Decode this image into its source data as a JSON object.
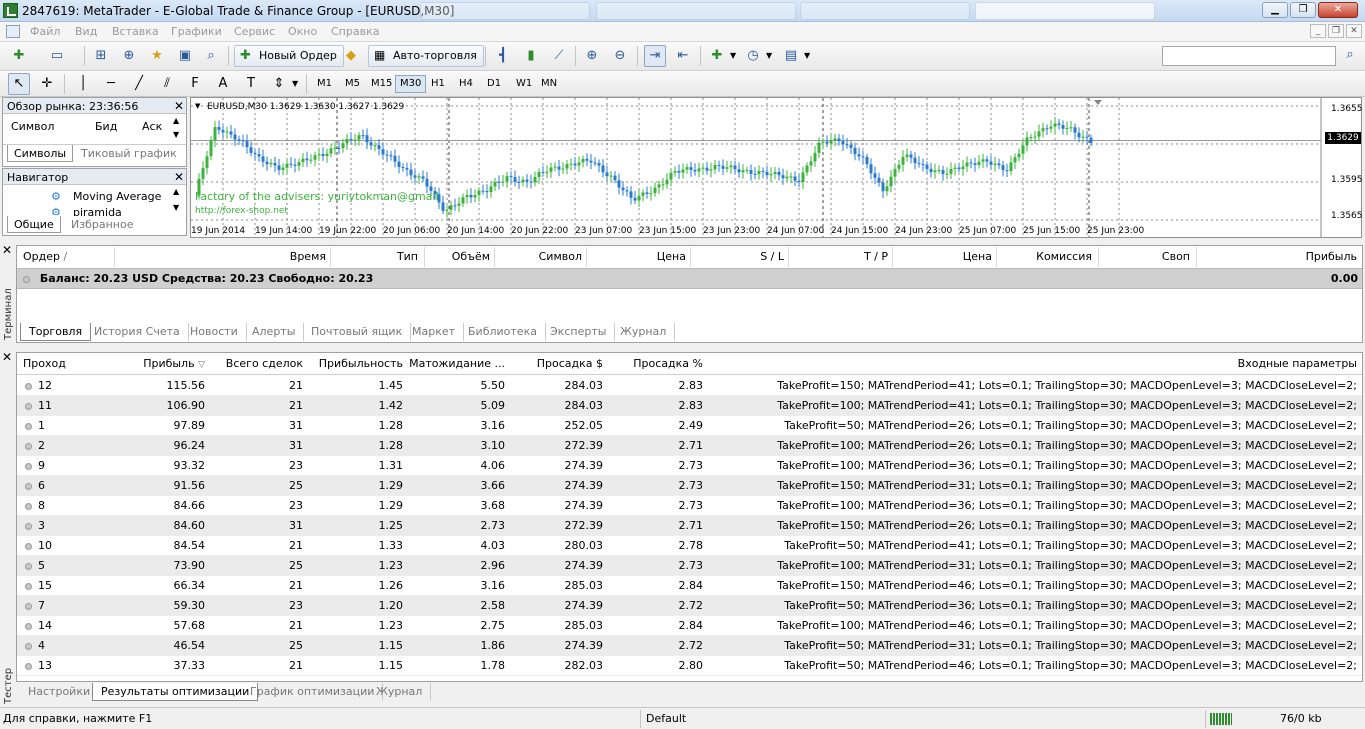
{
  "window": {
    "title": "2847619: MetaTrader - E-Global Trade & Finance Group - [EURUSD,M30]"
  },
  "menu": {
    "items": [
      "Файл",
      "Вид",
      "Вставка",
      "Графики",
      "Сервис",
      "Окно",
      "Справка"
    ]
  },
  "toolbar": {
    "new_order_label": "Новый Ордер",
    "autotrading_label": "Авто-торговля"
  },
  "timeframes": [
    "M1",
    "M5",
    "M15",
    "M30",
    "H1",
    "H4",
    "D1",
    "W1",
    "MN"
  ],
  "active_timeframe": "M30",
  "market_watch": {
    "title": "Обзор рынка: 23:36:56",
    "columns": {
      "symbol": "Символ",
      "bid": "Бид",
      "ask": "Аск"
    },
    "tabs": [
      "Символы",
      "Тиковый график"
    ]
  },
  "navigator": {
    "title": "Навигатор",
    "items": [
      "Moving Average",
      "piramida"
    ],
    "tabs": [
      "Общие",
      "Избранное"
    ]
  },
  "chart": {
    "header": "EURUSD,M30  1.3629 1.3630 1.3627 1.3629",
    "watermark_line1": "Factory of the advisers: yuriytokman@gmail",
    "watermark_line2": "http://forex-shop.net",
    "current_price": "1.3629",
    "bull_color": "#3cb43c",
    "bear_color": "#2a7bd0",
    "chart_data": {
      "type": "candlestick",
      "x_ticks": [
        "19 Jun 2014",
        "19 Jun 14:00",
        "19 Jun 22:00",
        "20 Jun 06:00",
        "20 Jun 14:00",
        "20 Jun 22:00",
        "23 Jun 07:00",
        "23 Jun 15:00",
        "23 Jun 23:00",
        "24 Jun 07:00",
        "24 Jun 15:00",
        "24 Jun 23:00",
        "25 Jun 07:00",
        "25 Jun 15:00",
        "25 Jun 23:00"
      ],
      "y_ticks": [
        "1.3655",
        "1.3629",
        "1.3595",
        "1.3565"
      ],
      "ylim": [
        1.356,
        1.366
      ],
      "close_path": [
        1.3585,
        1.364,
        1.3632,
        1.3614,
        1.3608,
        1.361,
        1.3618,
        1.3625,
        1.3633,
        1.362,
        1.3605,
        1.3598,
        1.357,
        1.3585,
        1.3588,
        1.36,
        1.3595,
        1.3606,
        1.361,
        1.3612,
        1.36,
        1.358,
        1.359,
        1.3603,
        1.3606,
        1.3608,
        1.3605,
        1.3604,
        1.36,
        1.3598,
        1.3626,
        1.363,
        1.3615,
        1.3588,
        1.3618,
        1.3606,
        1.3604,
        1.3608,
        1.3614,
        1.3604,
        1.3632,
        1.3641,
        1.3638,
        1.3629
      ]
    }
  },
  "terminal": {
    "side_label": "Терминал",
    "columns": [
      "Ордер",
      "Время",
      "Тип",
      "Объём",
      "Символ",
      "Цена",
      "S / L",
      "T / P",
      "Цена",
      "Комиссия",
      "Своп",
      "Прибыль"
    ],
    "balance_text": "Баланс: 20.23 USD  Средства: 20.23  Свободно: 20.23",
    "balance_profit": "0.00",
    "tabs": [
      "Торговля",
      "История Счета",
      "Новости",
      "Алерты",
      "Почтовый ящик",
      "Маркет",
      "Библиотека",
      "Эксперты",
      "Журнал"
    ]
  },
  "tester": {
    "side_label": "Тестер",
    "columns": [
      "Проход",
      "Прибыль",
      "Всего сделок",
      "Прибыльность",
      "Матожидание ...",
      "Просадка $",
      "Просадка %",
      "Входные параметры"
    ],
    "rows": [
      [
        "12",
        "115.56",
        "21",
        "1.45",
        "5.50",
        "284.03",
        "2.83",
        "TakeProfit=150; MATrendPeriod=41; Lots=0.1; TrailingStop=30; MACDOpenLevel=3; MACDCloseLevel=2;"
      ],
      [
        "11",
        "106.90",
        "21",
        "1.42",
        "5.09",
        "284.03",
        "2.83",
        "TakeProfit=100; MATrendPeriod=41; Lots=0.1; TrailingStop=30; MACDOpenLevel=3; MACDCloseLevel=2;"
      ],
      [
        "1",
        "97.89",
        "31",
        "1.28",
        "3.16",
        "252.05",
        "2.49",
        "TakeProfit=50; MATrendPeriod=26; Lots=0.1; TrailingStop=30; MACDOpenLevel=3; MACDCloseLevel=2;"
      ],
      [
        "2",
        "96.24",
        "31",
        "1.28",
        "3.10",
        "272.39",
        "2.71",
        "TakeProfit=100; MATrendPeriod=26; Lots=0.1; TrailingStop=30; MACDOpenLevel=3; MACDCloseLevel=2;"
      ],
      [
        "9",
        "93.32",
        "23",
        "1.31",
        "4.06",
        "274.39",
        "2.73",
        "TakeProfit=100; MATrendPeriod=36; Lots=0.1; TrailingStop=30; MACDOpenLevel=3; MACDCloseLevel=2;"
      ],
      [
        "6",
        "91.56",
        "25",
        "1.29",
        "3.66",
        "274.39",
        "2.73",
        "TakeProfit=150; MATrendPeriod=31; Lots=0.1; TrailingStop=30; MACDOpenLevel=3; MACDCloseLevel=2;"
      ],
      [
        "8",
        "84.66",
        "23",
        "1.29",
        "3.68",
        "274.39",
        "2.73",
        "TakeProfit=100; MATrendPeriod=36; Lots=0.1; TrailingStop=30; MACDOpenLevel=3; MACDCloseLevel=2;"
      ],
      [
        "3",
        "84.60",
        "31",
        "1.25",
        "2.73",
        "272.39",
        "2.71",
        "TakeProfit=150; MATrendPeriod=26; Lots=0.1; TrailingStop=30; MACDOpenLevel=3; MACDCloseLevel=2;"
      ],
      [
        "10",
        "84.54",
        "21",
        "1.33",
        "4.03",
        "280.03",
        "2.78",
        "TakeProfit=50; MATrendPeriod=41; Lots=0.1; TrailingStop=30; MACDOpenLevel=3; MACDCloseLevel=2;"
      ],
      [
        "5",
        "73.90",
        "25",
        "1.23",
        "2.96",
        "274.39",
        "2.73",
        "TakeProfit=100; MATrendPeriod=31; Lots=0.1; TrailingStop=30; MACDOpenLevel=3; MACDCloseLevel=2;"
      ],
      [
        "15",
        "66.34",
        "21",
        "1.26",
        "3.16",
        "285.03",
        "2.84",
        "TakeProfit=150; MATrendPeriod=46; Lots=0.1; TrailingStop=30; MACDOpenLevel=3; MACDCloseLevel=2;"
      ],
      [
        "7",
        "59.30",
        "23",
        "1.20",
        "2.58",
        "274.39",
        "2.72",
        "TakeProfit=50; MATrendPeriod=36; Lots=0.1; TrailingStop=30; MACDOpenLevel=3; MACDCloseLevel=2;"
      ],
      [
        "14",
        "57.68",
        "21",
        "1.23",
        "2.75",
        "285.03",
        "2.84",
        "TakeProfit=100; MATrendPeriod=46; Lots=0.1; TrailingStop=30; MACDOpenLevel=3; MACDCloseLevel=2;"
      ],
      [
        "4",
        "46.54",
        "25",
        "1.15",
        "1.86",
        "274.39",
        "2.72",
        "TakeProfit=50; MATrendPeriod=31; Lots=0.1; TrailingStop=30; MACDOpenLevel=3; MACDCloseLevel=2;"
      ],
      [
        "13",
        "37.33",
        "21",
        "1.15",
        "1.78",
        "282.03",
        "2.80",
        "TakeProfit=50; MATrendPeriod=46; Lots=0.1; TrailingStop=30; MACDOpenLevel=3; MACDCloseLevel=2;"
      ]
    ],
    "tabs": [
      "Настройки",
      "Результаты оптимизации",
      "График оптимизации",
      "Журнал"
    ],
    "active_tab": "Результаты оптимизации"
  },
  "statusbar": {
    "help": "Для справки, нажмите F1",
    "profile": "Default",
    "traffic": "76/0 kb"
  }
}
